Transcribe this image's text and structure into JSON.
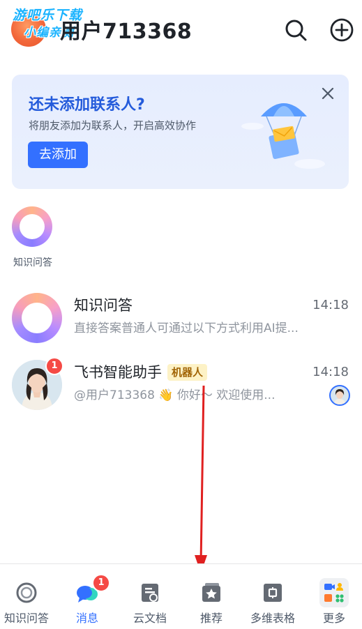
{
  "watermark": {
    "line1": "游吧乐下载",
    "line2": "小编亲测"
  },
  "header": {
    "title": "用户713368"
  },
  "banner": {
    "title": "还未添加联系人?",
    "subtitle": "将朋友添加为联系人，开启高效协作",
    "button": "去添加"
  },
  "quick_chip": {
    "label": "知识问答"
  },
  "chats": [
    {
      "name": "知识问答",
      "time": "14:18",
      "preview": "直接答案普通人可通过以下方式利用AI提..."
    },
    {
      "name": "飞书智能助手",
      "tag": "机器人",
      "time": "14:18",
      "preview": "@用户713368 👋 你好～ 欢迎使用...",
      "unread": "1"
    }
  ],
  "nav": {
    "items": [
      {
        "label": "知识问答",
        "icon": "ring-icon"
      },
      {
        "label": "消息",
        "icon": "chat-bubbles-icon",
        "badge": "1",
        "active": true
      },
      {
        "label": "云文档",
        "icon": "doc-icon"
      },
      {
        "label": "推荐",
        "icon": "star-folder-icon"
      },
      {
        "label": "多维表格",
        "icon": "table-icon"
      },
      {
        "label": "更多",
        "icon": "apps-icon"
      }
    ]
  },
  "colors": {
    "accent": "#3370ff",
    "badge": "#f54a45",
    "annotation_arrow": "#e02020"
  }
}
